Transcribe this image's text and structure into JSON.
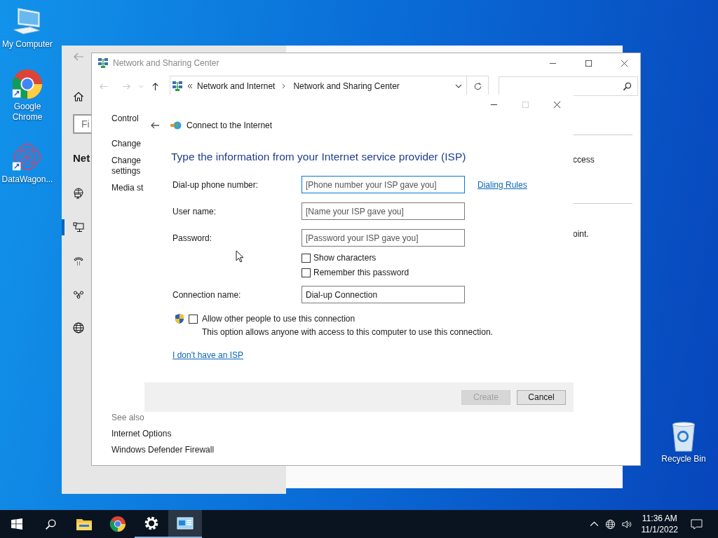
{
  "desktop_icons": [
    {
      "label": "My Computer",
      "kind": "computer"
    },
    {
      "label": "Google Chrome",
      "kind": "chrome"
    },
    {
      "label": "DataWagon...",
      "kind": "datawagon"
    },
    {
      "label": "Recycle Bin",
      "kind": "recycle"
    }
  ],
  "settings_window": {
    "search": {
      "placeholder": "Fi"
    },
    "heading": "Net",
    "nav": [
      {
        "kind": "network-status",
        "selected": false
      },
      {
        "kind": "ethernet",
        "selected": true
      },
      {
        "kind": "dialup",
        "selected": false
      },
      {
        "kind": "vpn",
        "selected": false
      },
      {
        "kind": "proxy",
        "selected": false
      }
    ]
  },
  "explorer_window": {
    "title": "Network and Sharing Center",
    "breadcrumbs": [
      "Network and Internet",
      "Network and Sharing Center"
    ],
    "left_links": [
      [
        "Control"
      ],
      [
        "Change"
      ],
      [
        "Change",
        "settings"
      ],
      [
        "Media st"
      ]
    ],
    "right_texts": [
      "ccess",
      "oint."
    ],
    "see_also": {
      "heading": "See also",
      "links": [
        "Internet Options",
        "Windows Defender Firewall"
      ]
    }
  },
  "dialog": {
    "title": "Connect to the Internet",
    "heading": "Type the information from your Internet service provider (ISP)",
    "fields": [
      {
        "label": "Dial-up phone number:",
        "placeholder": "[Phone number your ISP gave you]",
        "focused": true,
        "link": "Dialing Rules"
      },
      {
        "label": "User name:",
        "placeholder": "[Name your ISP gave you]",
        "focused": false
      },
      {
        "label": "Password:",
        "placeholder": "[Password your ISP gave you]",
        "focused": false,
        "options": [
          {
            "label": "Show characters",
            "checked": false
          },
          {
            "label": "Remember this password",
            "checked": false
          }
        ]
      },
      {
        "label": "Connection name:",
        "value": "Dial-up Connection",
        "focused": false
      }
    ],
    "share": {
      "label": "Allow other people to use this connection",
      "checked": false,
      "description": "This option allows anyone with access to this computer to use this connection."
    },
    "link": "I don't have an ISP",
    "buttons": [
      {
        "label": "Create",
        "disabled": true
      },
      {
        "label": "Cancel",
        "disabled": false
      }
    ]
  },
  "taskbar": {
    "apps": [
      {
        "kind": "explorer",
        "running": false,
        "selected": false
      },
      {
        "kind": "chrome",
        "running": false,
        "selected": false
      },
      {
        "kind": "settings",
        "running": true,
        "selected": false
      },
      {
        "kind": "control-panel",
        "running": true,
        "selected": true
      }
    ],
    "time": "11:36 AM",
    "date": "11/1/2022"
  }
}
